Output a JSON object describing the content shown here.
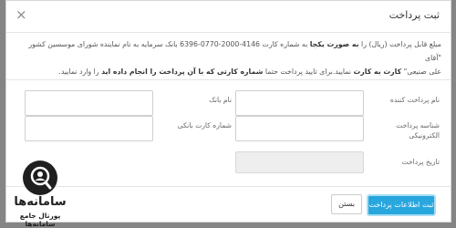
{
  "modal": {
    "title": "ثبت پرداخت",
    "close_glyph": "×",
    "notice": {
      "line1_a": "مبلغ قابل پرداخت (",
      "line1_b": "ریال) را ",
      "line1_c": "به صورت یکجا",
      "line1_d": " به شماره کارت 4146-2000-0770-6396 بانک سرمایه به نام نماینده شورای موسسین کشور \"آقای",
      "line2_a": "علی صنیعی\" ",
      "line2_b": "کارت به کارت",
      "line2_c": " نمایید.برای تایید پرداخت حتما ",
      "line2_d": "شماره کارتی که با آن پرداخت را انجام داده اید",
      "line2_e": " را وارد نمایید."
    },
    "fields": {
      "payer_name": "نام پرداخت کننده",
      "bank_name": "نام بانک",
      "electronic_id": "شناسه پرداخت الکترونیکی",
      "card_number": "شماره کارت بانکی",
      "payment_date": "تاریخ پرداخت"
    },
    "buttons": {
      "submit": "ثبت اطلاعات پرداخت",
      "close": "بستن"
    }
  },
  "watermark": {
    "brand": "سامانه‌ها",
    "tagline": "پورتال جامع سامانه‌ها"
  },
  "colors": {
    "primary": "#28a6de",
    "backdrop": "#858585",
    "input_disabled": "#eeeeee"
  }
}
